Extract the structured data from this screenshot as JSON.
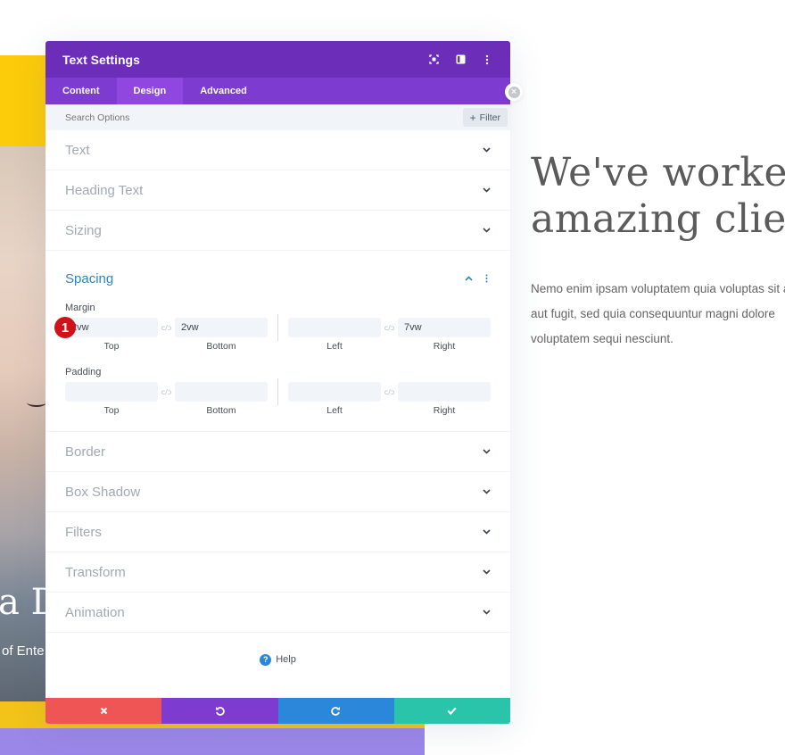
{
  "background": {
    "hero_title": "a D",
    "hero_subtitle": "of Ente",
    "right_heading_lines": [
      "We've worked",
      "amazing clien"
    ],
    "right_body_lines": [
      "Nemo enim ipsam voluptatem quia voluptas sit a",
      "aut fugit, sed quia consequuntur magni dolore",
      "voluptatem sequi nesciunt."
    ]
  },
  "modal": {
    "title": "Text Settings",
    "header_icons": [
      "focus-icon",
      "split-view-icon",
      "more-vertical-icon"
    ],
    "tabs": [
      {
        "label": "Content",
        "active": false
      },
      {
        "label": "Design",
        "active": true
      },
      {
        "label": "Advanced",
        "active": false
      }
    ],
    "search": {
      "placeholder": "Search Options",
      "value": ""
    },
    "filter_label": "Filter",
    "sections_before": [
      {
        "label": "Text"
      },
      {
        "label": "Heading Text"
      },
      {
        "label": "Sizing"
      }
    ],
    "spacing": {
      "title": "Spacing",
      "expanded": true,
      "margin": {
        "label": "Margin",
        "top": "2vw",
        "bottom": "2vw",
        "left": "",
        "right": "7vw"
      },
      "padding": {
        "label": "Padding",
        "top": "",
        "bottom": "",
        "left": "",
        "right": ""
      },
      "side_labels": {
        "top": "Top",
        "bottom": "Bottom",
        "left": "Left",
        "right": "Right"
      },
      "step_badge": "1"
    },
    "sections_after": [
      {
        "label": "Border"
      },
      {
        "label": "Box Shadow"
      },
      {
        "label": "Filters"
      },
      {
        "label": "Transform"
      },
      {
        "label": "Animation"
      }
    ],
    "help_label": "Help",
    "footer": {
      "cancel": "cancel",
      "undo": "undo",
      "redo": "redo",
      "save": "save"
    }
  },
  "colors": {
    "header": "#6c2eb9",
    "tabs": "#7d3bcf",
    "tab_active": "#8f47e0",
    "spacing_title": "#2b87c2",
    "cancel": "#ef5555",
    "undo": "#7e3bd0",
    "redo": "#2b87da",
    "save": "#29c4a9",
    "badge": "#d0111a"
  }
}
